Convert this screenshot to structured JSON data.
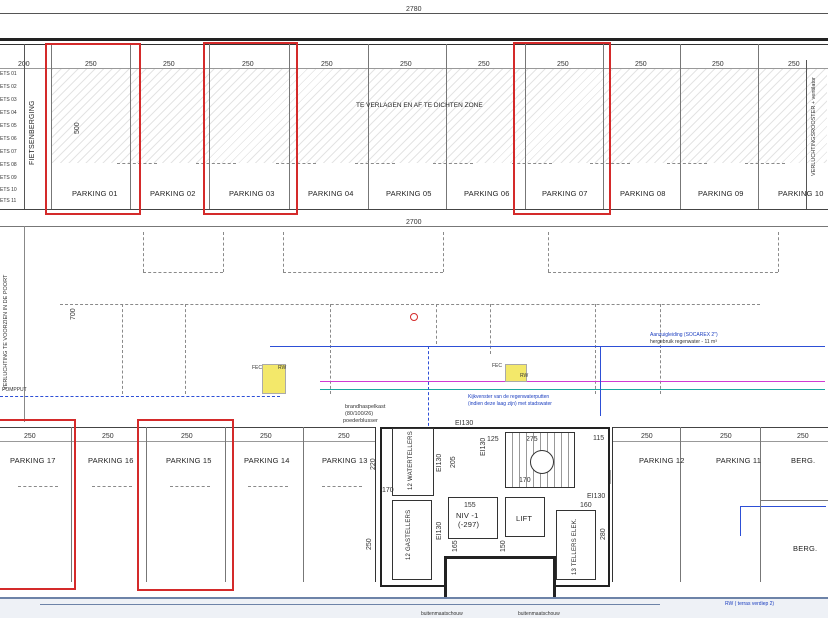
{
  "drawing": {
    "overall_dim_top": "2780",
    "overall_dim_mid": "2700",
    "top_bay_dims": [
      "200",
      "250",
      "250",
      "250",
      "250",
      "250",
      "250",
      "250",
      "250",
      "250",
      "250",
      "250"
    ],
    "bottom_bay_dims": [
      "250",
      "250",
      "250",
      "250",
      "250",
      "250",
      "250",
      "250",
      "250",
      "250"
    ],
    "zone_label": "TE VERLAGEN EN AF TE DICHTEN ZONE",
    "bike_storage": "FIETSENBERGING",
    "ventilation_right": "VERLUCHTINGSROOSTER + ventilator",
    "ventilation_left": "VERLUCHTING TE VOORZIEN IN DE POORT",
    "depth_dim_top": "500",
    "depth_dim_mid": "700",
    "dim_250_vertical": "250",
    "dim_220": "220",
    "dim_170": "170",
    "dim_205": "205",
    "dim_125": "125",
    "dim_275": "275",
    "dim_115": "115",
    "dim_155": "155",
    "dim_160": "160",
    "dim_165": "165",
    "dim_280": "280",
    "dim_150": "150",
    "ei_label": "EI130",
    "bike_rows": [
      "ETS 01",
      "ETS 02",
      "ETS 03",
      "ETS 04",
      "ETS 05",
      "ETS 06",
      "ETS 07",
      "ETS 08",
      "ETS 09",
      "ETS 10",
      "ETS 11"
    ]
  },
  "parking_top": [
    "PARKING 01",
    "PARKING 02",
    "PARKING 03",
    "PARKING 04",
    "PARKING 05",
    "PARKING 06",
    "PARKING 07",
    "PARKING 08",
    "PARKING 09",
    "PARKING 10"
  ],
  "parking_bottom": [
    "PARKING 17",
    "PARKING 16",
    "PARKING 15",
    "PARKING 14",
    "PARKING 13",
    "PARKING 12",
    "PARKING 11"
  ],
  "storage": [
    "BERG.",
    "BERG."
  ],
  "core": {
    "fire": "brandhaspelkast",
    "fire_dims": "(80/100/26)",
    "extinguisher": "poederblusser",
    "water_meters": "12 WATERTELLERS",
    "gas_meters": "12 GASTELLERS",
    "elec_meters": "13 TELLERS ELEK.",
    "level": "NIV -1",
    "level_value": "(-297)",
    "lift": "LIFT",
    "rainwater_note_1": "Aanzuigleiding (SOCAREX 2\")",
    "rainwater_note_2": "hergebruik regenwater - 11 m³",
    "pit_note_1": "Kijkvenster van de regenwaterputten",
    "pit_note_2": "(indien deze laag zijn) met stadswater",
    "rw_note": "RW ( terras verdiep 2)",
    "pompput": "POMPPUT",
    "facade_1": "buitenmaatschouw",
    "facade_2": "buitenmaatschouw",
    "rw": "RW",
    "fec": "FEC"
  },
  "colors": {
    "highlight": "#d42a2a",
    "pipe_blue": "#2d4fd6",
    "pipe_magenta": "#d23ad2",
    "pipe_teal": "#19a7a0",
    "symbol_yellow": "#f3e86a",
    "facade_blue": "#6d83a8"
  }
}
